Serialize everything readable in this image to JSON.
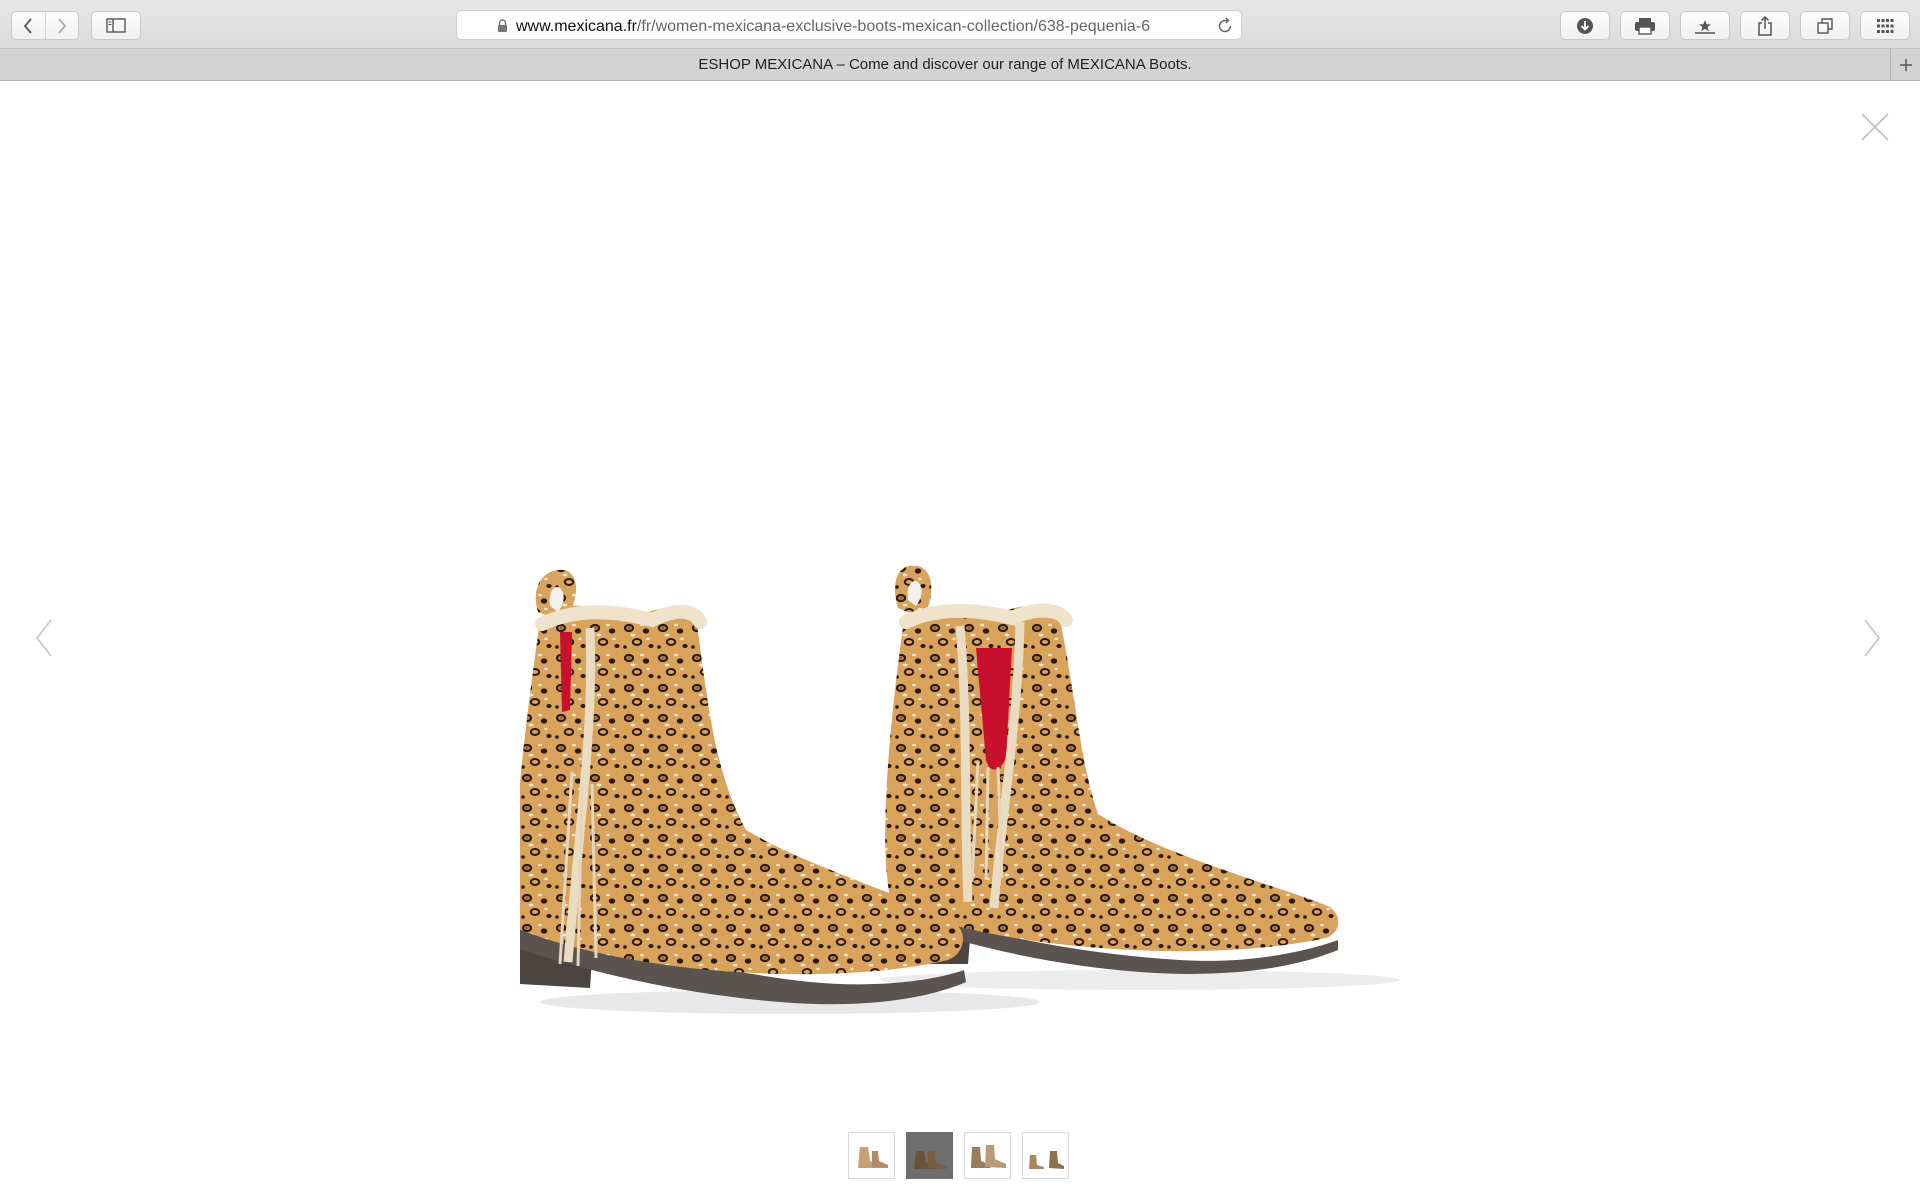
{
  "browser": {
    "url_domain": "www.mexicana.fr",
    "url_path": "/fr/women-mexicana-exclusive-boots-mexican-collection/638-pequenia-6",
    "tab_title": "ESHOP MEXICANA – Come and discover our range of MEXICANA Boots."
  },
  "colors": {
    "toolbar": "#dcdbdc",
    "tab_bar": "#d4d3d4",
    "active_thumb": "#6e6e6e",
    "boot_red_accent": "#c8102e"
  },
  "icons": {
    "back": "chevron-left-icon",
    "forward": "chevron-right-icon",
    "sidebar": "sidebar-icon",
    "lock": "lock-icon",
    "reload": "reload-icon",
    "downloads": "download-icon",
    "print": "printer-icon",
    "reading_list": "star-icon",
    "share": "share-icon",
    "tabs": "tabs-overview-icon",
    "apps": "grid-icon",
    "new_tab": "plus-icon",
    "close": "close-icon",
    "prev": "chevron-left-icon",
    "next": "chevron-right-icon"
  },
  "gallery": {
    "thumbnail_count": 4,
    "active_thumbnail": 2
  }
}
